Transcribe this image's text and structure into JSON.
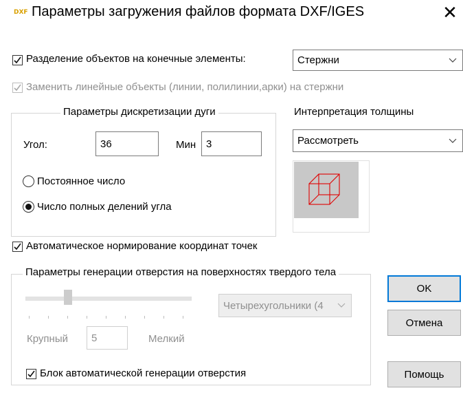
{
  "window": {
    "title": "Параметры загружения файлов формата DXF/IGES",
    "icon": "DXF"
  },
  "split_objects": {
    "checked": true,
    "label": "Разделение объектов на конечные элементы:",
    "selected": "Стержни"
  },
  "replace_linear": {
    "checked": true,
    "disabled": true,
    "label": "Заменить линейные объекты (линии, полилинии,арки) на стержни"
  },
  "arc_group": {
    "title": "Параметры дискретизации дуги",
    "angle_label": "Угол:",
    "angle_value": "36",
    "min_label": "Мин",
    "min_value": "3",
    "radio_constant": "Постоянное число",
    "radio_full": "Число полных делений угла",
    "selected_radio": "full"
  },
  "thickness": {
    "label": "Интерпретация толщины",
    "selected": "Рассмотреть",
    "preview_line_color": "#e00000"
  },
  "auto_normalize": {
    "checked": true,
    "label": "Автоматическое нормирование координат точек"
  },
  "hole_group": {
    "title": "Параметры генерации отверстия на поверхностях твердого тела",
    "slider_left_label": "Крупный",
    "slider_value": "5",
    "slider_right_label": "Мелкий",
    "mesh_type": "Четырехугольники (4"
  },
  "block_auto": {
    "checked": true,
    "label": "Блок автоматической генерации отверстия"
  },
  "buttons": {
    "ok": "OK",
    "cancel": "Отмена",
    "help": "Помощь"
  },
  "colors": {
    "accent": "#0078d7"
  }
}
